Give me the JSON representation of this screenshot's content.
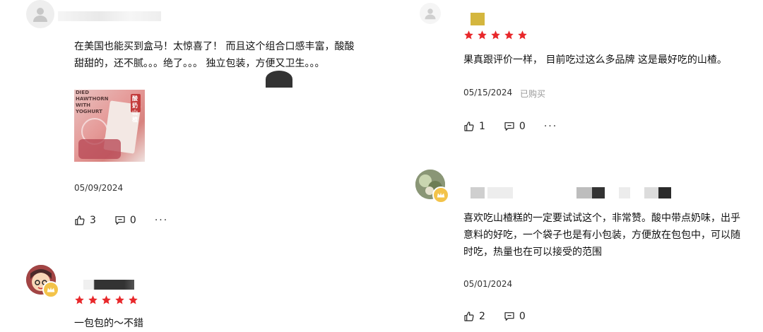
{
  "reviews_left": [
    {
      "text_line1": "在美国也能买到盒马！太惊喜了！ 而且这个组合口感丰富，酸酸",
      "text_line2": "甜甜的，还不腻。。。绝了。。。 独立包装，方便又卫生。。。",
      "date": "05/09/2024",
      "likes": "3",
      "comments": "0",
      "more": "···"
    },
    {
      "text": "一包包的～不錯"
    }
  ],
  "reviews_right": [
    {
      "text": "果真跟评价一样， 目前吃过这么多品牌 这是最好吃的山楂。",
      "date": "05/15/2024",
      "purchased": "已购买",
      "likes": "1",
      "comments": "0",
      "more": "···"
    },
    {
      "text_line1": "喜欢吃山楂糕的一定要试试这个，非常赞。酸中带点奶味，出乎",
      "text_line2": "意料的好吃，一个袋子也是有小包装，方便放在包包中，可以随",
      "text_line3": "时吃，热量也在可以接受的范围",
      "date": "05/01/2024",
      "likes": "2",
      "comments": "0"
    }
  ],
  "photo": {
    "label_top": "DIED\nHAWTHORN\nWITH\nYOGHURT",
    "label_side": "酸奶山楂"
  },
  "colors": {
    "star": "#e8282b",
    "crown": "#f3c34a",
    "placeholder_avatar": "#eeeeee"
  },
  "icons": [
    "user-icon",
    "crown-icon",
    "star-icon",
    "like-icon",
    "comment-icon",
    "more-icon"
  ]
}
